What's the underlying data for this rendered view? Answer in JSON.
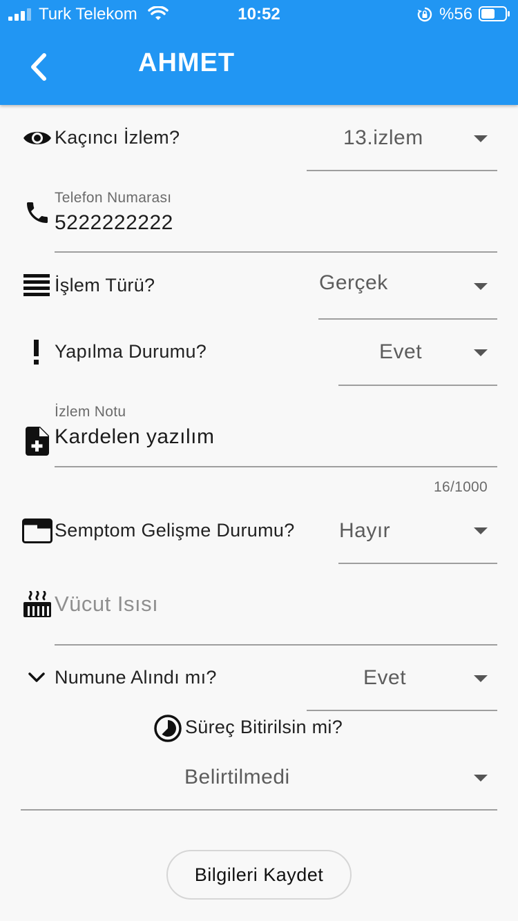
{
  "status_bar": {
    "carrier": "Turk Telekom",
    "time": "10:52",
    "battery": "%56"
  },
  "appbar": {
    "title": "AHMET"
  },
  "form": {
    "visit": {
      "label": "Kaçıncı İzlem?",
      "value": "13.izlem"
    },
    "phone": {
      "label": "Telefon Numarası",
      "value": "5222222222"
    },
    "operation_type": {
      "label": "İşlem Türü?",
      "value": "Gerçek"
    },
    "done_status": {
      "label": "Yapılma Durumu?",
      "value": "Evet"
    },
    "visit_note": {
      "label": "İzlem Notu",
      "value": "Kardelen yazılım",
      "counter": "16/1000"
    },
    "symptom": {
      "label": "Semptom Gelişme Durumu?",
      "value": "Hayır"
    },
    "body_temp": {
      "placeholder": "Vücut Isısı"
    },
    "sample": {
      "label": "Numune Alındı mı?",
      "value": "Evet"
    },
    "finish_process": {
      "label": "Süreç Bitirilsin mi?",
      "value": "Belirtilmedi"
    },
    "save_label": "Bilgileri Kaydet"
  },
  "colors": {
    "primary": "#2196f3",
    "background": "#f8f8f8"
  },
  "icons": [
    "signal-icon",
    "wifi-icon",
    "rotation-lock-icon",
    "battery-icon",
    "back-icon",
    "eye-icon",
    "phone-icon",
    "list-icon",
    "exclamation-icon",
    "note-add-icon",
    "web-asset-icon",
    "heater-icon",
    "chevron-down-icon",
    "timelapse-icon",
    "dropdown-caret-icon"
  ]
}
